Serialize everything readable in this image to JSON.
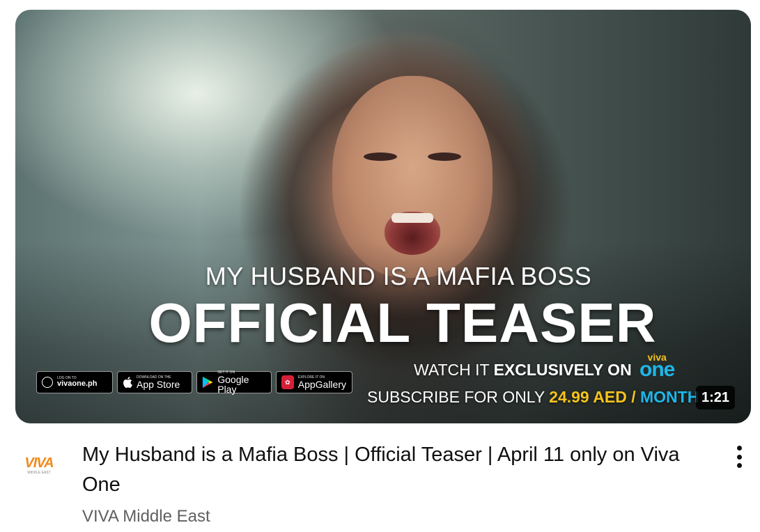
{
  "video": {
    "title": "My Husband is a Mafia Boss | Official Teaser | April 11 only on Viva One",
    "channel": "VIVA Middle East",
    "duration": "1:21"
  },
  "thumbnail": {
    "subtitle": "MY HUSBAND IS A MAFIA BOSS",
    "headline": "OFFICIAL TEASER",
    "watch_prefix": "WATCH IT",
    "watch_bold": "EXCLUSIVELY ON",
    "viva_one_top": "viva",
    "viva_one_bottom": "one",
    "sub_prefix": "SUBSCRIBE FOR ONLY",
    "sub_price": "24.99 AED /",
    "sub_month": "MONTH",
    "badges": {
      "web_small": "LOG ON TO",
      "web_big": "vivaone.ph",
      "apple_small": "Download on the",
      "apple_big": "App Store",
      "google_small": "GET IT ON",
      "google_big": "Google Play",
      "huawei_small": "EXPLORE IT ON",
      "huawei_big": "AppGallery"
    }
  },
  "channel_logo": {
    "word": "VIVA",
    "sub": "MIDDLE EAST"
  },
  "icons": {
    "web": "globe-icon",
    "apple": "apple-icon",
    "google": "google-play-icon",
    "huawei": "huawei-icon",
    "menu": "more-vert-icon"
  },
  "colors": {
    "price_yellow": "#f7c31d",
    "month_blue": "#1fb6e8",
    "channel_text": "#606060"
  }
}
